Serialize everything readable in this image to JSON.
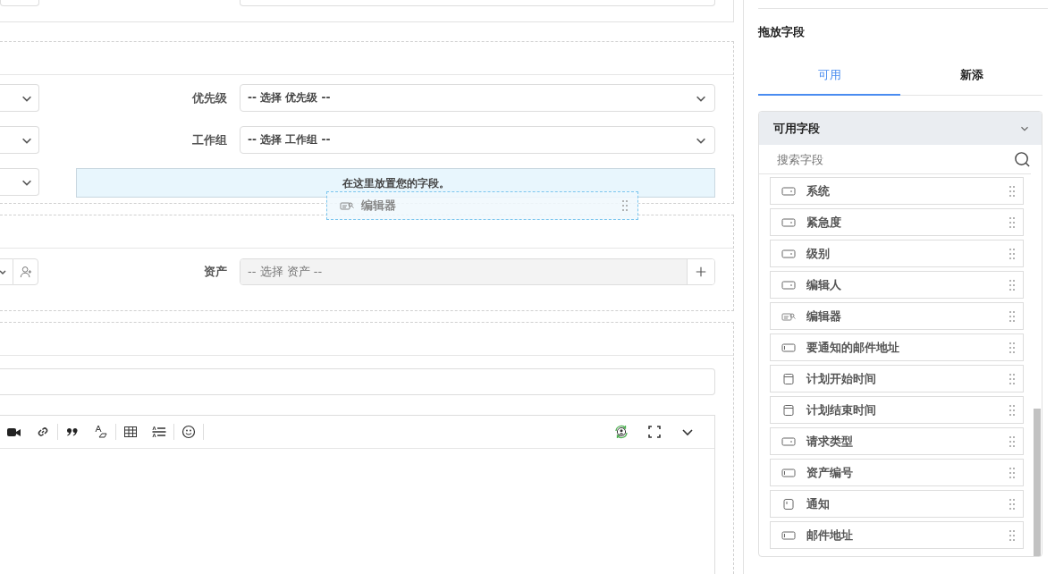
{
  "details_section": {
    "rows": [
      {
        "label": "优先级",
        "value": "-- 选择 优先级 --"
      },
      {
        "label": "工作组",
        "value": "-- 选择 工作组 --"
      }
    ],
    "drop_zone": "在这里放置您的字段。",
    "drag_ghost": {
      "label": "编辑器",
      "kind": "editor"
    }
  },
  "asset_section": {
    "label": "资产",
    "placeholder": "-- 选择 资产 --",
    "disabled": true
  },
  "editor_section": {
    "toolbar_left": [
      {
        "kind": "video"
      },
      {
        "kind": "link"
      },
      {
        "kind": "quote"
      },
      {
        "kind": "format"
      },
      {
        "kind": "table"
      },
      {
        "kind": "lineheight"
      },
      {
        "kind": "emoji"
      }
    ],
    "toolbar_right": [
      {
        "kind": "sync"
      },
      {
        "kind": "fullscreen"
      },
      {
        "kind": "more"
      }
    ]
  },
  "sidebar": {
    "title": "拖放字段",
    "tabs": [
      {
        "label": "可用",
        "selected": true
      },
      {
        "label": "新添",
        "selected": false
      }
    ],
    "panel": {
      "title": "可用字段",
      "expanded": true,
      "search_placeholder": "搜索字段",
      "fields": [
        {
          "label": "系统",
          "kind": "select"
        },
        {
          "label": "紧急度",
          "kind": "select"
        },
        {
          "label": "级别",
          "kind": "select"
        },
        {
          "label": "编辑人",
          "kind": "select"
        },
        {
          "label": "编辑器",
          "kind": "editor"
        },
        {
          "label": "要通知的邮件地址",
          "kind": "text"
        },
        {
          "label": "计划开始时间",
          "kind": "date"
        },
        {
          "label": "计划结束时间",
          "kind": "date"
        },
        {
          "label": "请求类型",
          "kind": "select"
        },
        {
          "label": "资产编号",
          "kind": "text"
        },
        {
          "label": "通知",
          "kind": "checkbox"
        },
        {
          "label": "邮件地址",
          "kind": "text"
        }
      ]
    }
  }
}
